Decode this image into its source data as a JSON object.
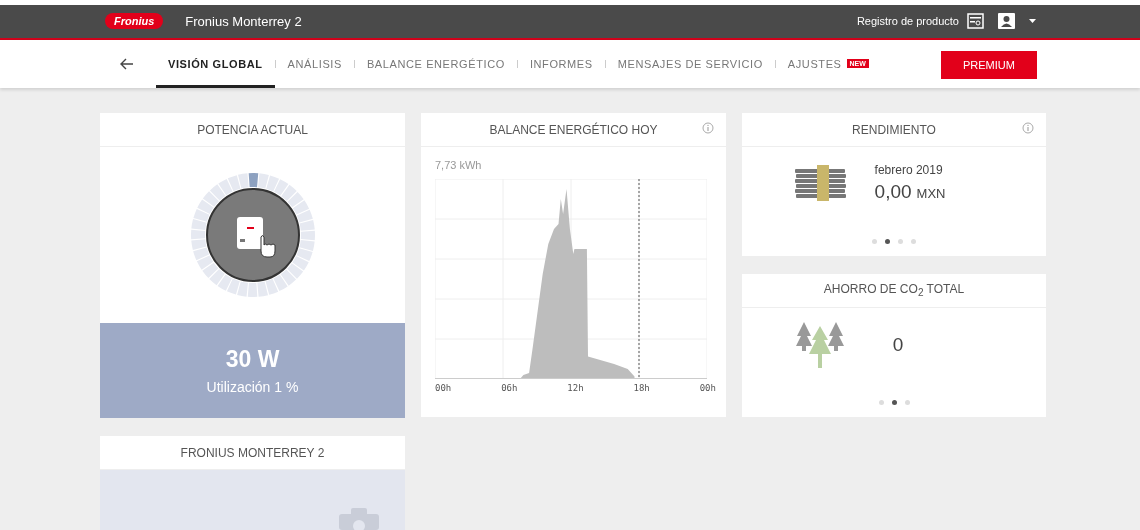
{
  "header": {
    "logo": "Fronius",
    "site": "Fronius Monterrey 2",
    "register": "Registro de producto"
  },
  "nav": {
    "tabs": [
      {
        "label": "VISIÓN GLOBAL",
        "selected": true
      },
      {
        "label": "ANÁLISIS",
        "selected": false
      },
      {
        "label": "BALANCE ENERGÉTICO",
        "selected": false
      },
      {
        "label": "INFORMES",
        "selected": false
      },
      {
        "label": "MENSAJES DE SERVICIO",
        "selected": false
      },
      {
        "label": "AJUSTES",
        "selected": false,
        "badge": "NEW"
      }
    ],
    "premium": "PREMIUM"
  },
  "power": {
    "title": "POTENCIA ACTUAL",
    "value": "30 W",
    "utilization": "Utilización 1 %"
  },
  "balance": {
    "title": "BALANCE ENERGÉTICO HOY",
    "total": "7,73 kWh",
    "xticks": [
      "00h",
      "06h",
      "12h",
      "18h",
      "00h"
    ]
  },
  "yield": {
    "title": "RENDIMIENTO",
    "period": "febrero 2019",
    "amount": "0,00",
    "currency": "MXN",
    "dots": [
      {
        "selected": false
      },
      {
        "selected": true
      },
      {
        "selected": false
      },
      {
        "selected": false
      }
    ]
  },
  "co2": {
    "title": "AHORRO DE CO$_{2}$ TOTAL",
    "value": "0",
    "dots": [
      {
        "selected": false
      },
      {
        "selected": true
      },
      {
        "selected": false
      }
    ]
  },
  "system": {
    "title": "FRONIUS MONTERREY 2"
  }
}
